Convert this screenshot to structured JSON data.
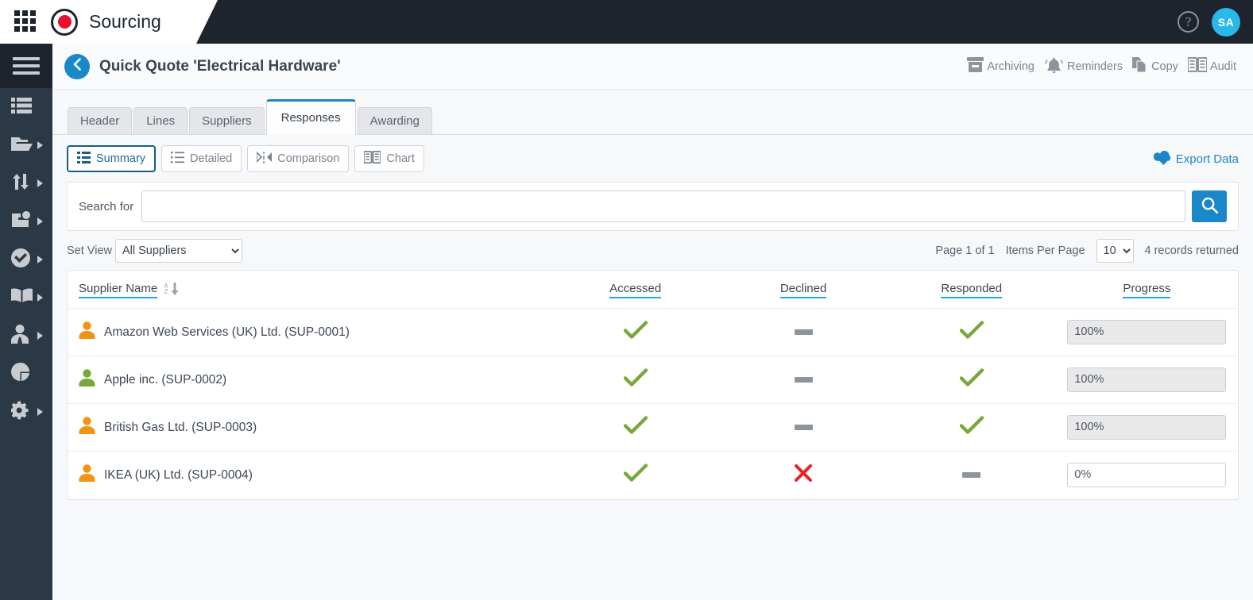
{
  "topbar": {
    "app_name": "Sourcing",
    "grid_icon": "app-grid-icon",
    "logo_icon": "record-dot-logo",
    "help_icon": "question-mark-icon",
    "help_label": "?",
    "avatar_initials": "SA",
    "accent_avatar": "#28b9e8",
    "logo_red": "#e8112d"
  },
  "sidebar": {
    "toggle_icon": "hamburger-menu-icon",
    "items": [
      {
        "icon": "list-icon",
        "name": "dashboard",
        "caret": false
      },
      {
        "icon": "folder-open-icon",
        "name": "projects",
        "caret": true
      },
      {
        "icon": "transfer-arrows-icon",
        "name": "transfers",
        "caret": true
      },
      {
        "icon": "add-box-icon",
        "name": "create",
        "caret": true
      },
      {
        "icon": "check-circle-icon",
        "name": "approvals",
        "caret": true
      },
      {
        "icon": "open-book-icon",
        "name": "catalogue",
        "caret": true
      },
      {
        "icon": "user-tie-icon",
        "name": "suppliers",
        "caret": true
      },
      {
        "icon": "pie-chart-icon",
        "name": "reports",
        "caret": false
      },
      {
        "icon": "gear-icon",
        "name": "settings",
        "caret": true
      }
    ]
  },
  "page_header": {
    "back_icon": "chevron-left-icon",
    "title": "Quick Quote 'Electrical Hardware'",
    "actions": [
      {
        "label": "Archiving",
        "icon": "archive-box-icon"
      },
      {
        "label": "Reminders",
        "icon": "bell-icon"
      },
      {
        "label": "Copy",
        "icon": "copy-pages-icon"
      },
      {
        "label": "Audit",
        "icon": "open-book-icon"
      }
    ]
  },
  "tabs": [
    {
      "label": "Header",
      "active": false
    },
    {
      "label": "Lines",
      "active": false
    },
    {
      "label": "Suppliers",
      "active": false
    },
    {
      "label": "Responses",
      "active": true
    },
    {
      "label": "Awarding",
      "active": false
    }
  ],
  "toolbar": {
    "views": [
      {
        "label": "Summary",
        "icon": "summary-list-icon",
        "active": true
      },
      {
        "label": "Detailed",
        "icon": "detailed-list-icon",
        "active": false
      },
      {
        "label": "Comparison",
        "icon": "comparison-icon",
        "active": false
      },
      {
        "label": "Chart",
        "icon": "chart-book-icon",
        "active": false
      }
    ],
    "export_label": "Export Data",
    "export_icon": "cloud-download-icon",
    "accent_blue": "#1a87c8"
  },
  "search": {
    "label": "Search for",
    "value": "",
    "placeholder": "",
    "button_icon": "search-icon"
  },
  "viewbar": {
    "set_view_label": "Set View",
    "set_view_value": "All Suppliers",
    "set_view_options": [
      "All Suppliers"
    ],
    "page_info": "Page 1 of 1",
    "items_per_page_label": "Items Per Page",
    "items_per_page_value": "10",
    "items_per_page_options": [
      "10"
    ],
    "records_returned": "4 records returned"
  },
  "table": {
    "columns": [
      {
        "label": "Supplier Name",
        "sortable": true,
        "sort_icon": "sort-az-down-icon"
      },
      {
        "label": "Accessed",
        "sortable": true
      },
      {
        "label": "Declined",
        "sortable": true
      },
      {
        "label": "Responded",
        "sortable": true
      },
      {
        "label": "Progress",
        "sortable": true
      }
    ],
    "rows": [
      {
        "icon": "supplier-person-icon",
        "icon_color": "#f39313",
        "name": "Amazon Web Services (UK) Ltd. (SUP-0001)",
        "accessed": "check",
        "declined": "dash",
        "responded": "check",
        "progress": "100%",
        "progress_filled": true
      },
      {
        "icon": "supplier-person-icon",
        "icon_color": "#76a93a",
        "name": "Apple inc. (SUP-0002)",
        "accessed": "check",
        "declined": "dash",
        "responded": "check",
        "progress": "100%",
        "progress_filled": true
      },
      {
        "icon": "supplier-person-icon",
        "icon_color": "#f39313",
        "name": "British Gas Ltd. (SUP-0003)",
        "accessed": "check",
        "declined": "dash",
        "responded": "check",
        "progress": "100%",
        "progress_filled": true
      },
      {
        "icon": "supplier-person-icon",
        "icon_color": "#f39313",
        "name": "IKEA (UK) Ltd. (SUP-0004)",
        "accessed": "check",
        "declined": "cross",
        "responded": "dash",
        "progress": "0%",
        "progress_filled": false
      }
    ],
    "status_colors": {
      "check": "#76a93a",
      "cross": "#ec2227",
      "dash": "#8d949d"
    }
  }
}
